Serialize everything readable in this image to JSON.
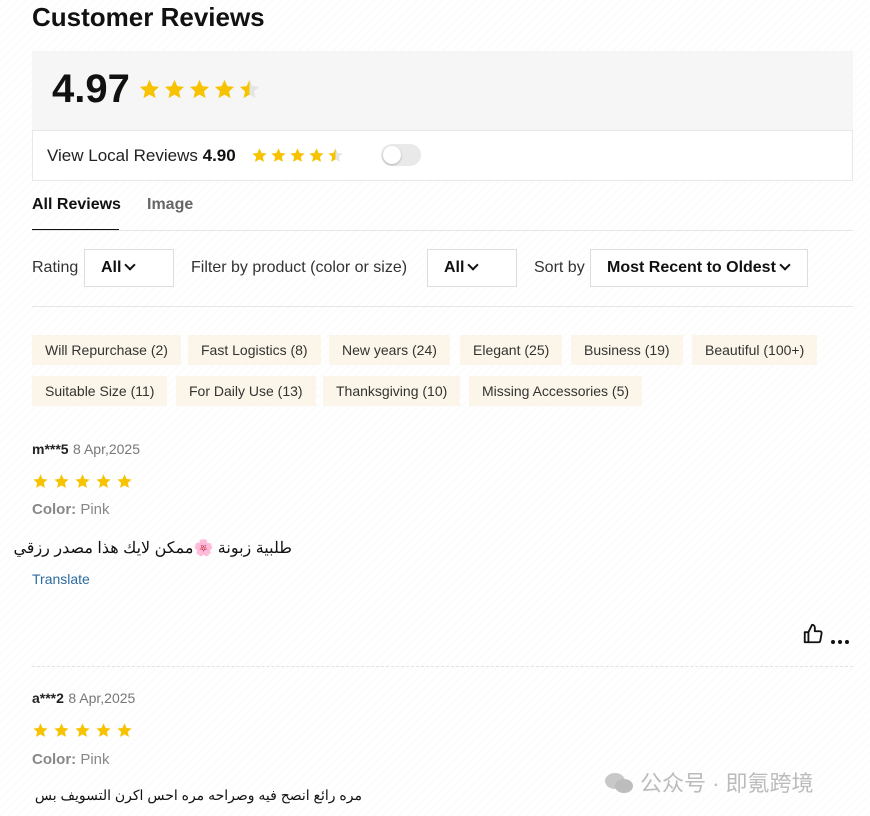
{
  "header": {
    "title": "Customer Reviews"
  },
  "summary": {
    "score": "4.97",
    "stars": 4.5
  },
  "local": {
    "label": "View Local Reviews",
    "score": "4.90",
    "stars": 4.5
  },
  "tabs": [
    {
      "label": "All Reviews"
    },
    {
      "label": "Image"
    }
  ],
  "filters": {
    "rating_label": "Rating",
    "rating_value": "All",
    "product_label": "Filter by product  (color or size)",
    "product_value": "All",
    "sort_label": "Sort by",
    "sort_value": "Most Recent to Oldest"
  },
  "tags": [
    "Will Repurchase (2)",
    "Fast Logistics (8)",
    "New years (24)",
    "Elegant (25)",
    "Business (19)",
    "Beautiful (100+)",
    "Suitable Size (11)",
    "For Daily Use (13)",
    "Thanksgiving (10)",
    "Missing Accessories (5)"
  ],
  "reviews": [
    {
      "user": "m***5",
      "date": "8 Apr,2025",
      "stars": 5,
      "color_label": "Color:",
      "color_value": "Pink",
      "text": "طلبية زبونة 🌸ممكن لايك هذا مصدر رزقي",
      "translate": "Translate"
    },
    {
      "user": "a***2",
      "date": "8 Apr,2025",
      "stars": 5,
      "color_label": "Color:",
      "color_value": "Pink",
      "text": "مره رائع انصح فيه وصراحه مره احس اكرن التسويف بس"
    }
  ],
  "watermark": {
    "text": "公众号 · 即氪跨境"
  },
  "colors": {
    "star": "#f7c200",
    "tag_bg": "#fbf6e9",
    "link": "#2d6a9f"
  },
  "icons": {
    "star": "star-icon",
    "thumbs_up": "thumbs-up-icon",
    "more": "more-icon"
  }
}
